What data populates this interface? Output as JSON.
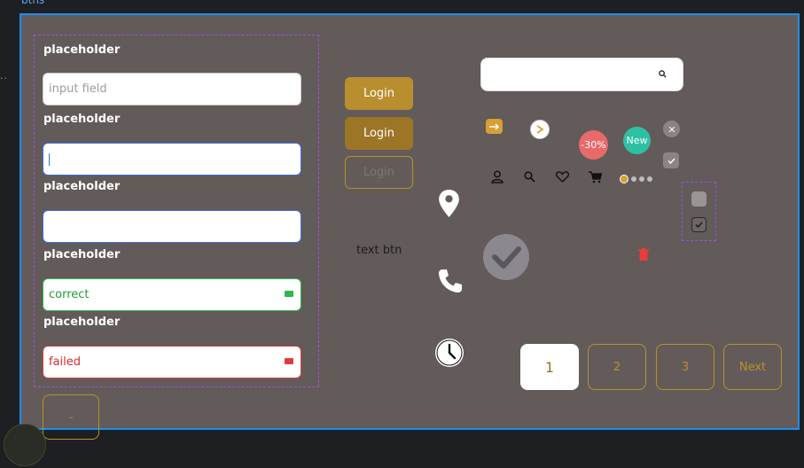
{
  "frame": {
    "label": "btns"
  },
  "form": {
    "label1": "placeholder",
    "input1_placeholder": "input field",
    "label2": "placeholder",
    "label3": "placeholder",
    "label4": "placeholder",
    "correct_value": "correct",
    "label5": "placeholder",
    "failed_value": "failed"
  },
  "buttons": {
    "small_label": "–",
    "login1": "Login",
    "login2": "Login",
    "login3": "Login",
    "text_btn": "text btn"
  },
  "badges": {
    "discount": "-30%",
    "new": "New"
  },
  "pagination": {
    "p1": "1",
    "p2": "2",
    "p3": "3",
    "next": "Next"
  },
  "colors": {
    "frame_bg": "#625b59",
    "accent_gold": "#b8912b",
    "selection_blue": "#1c8ef0",
    "group_purple": "#9b51d9",
    "success": "#2db84b",
    "error": "#e23b3b",
    "badge_red": "#e96a6a",
    "badge_teal": "#2dc1a4"
  }
}
